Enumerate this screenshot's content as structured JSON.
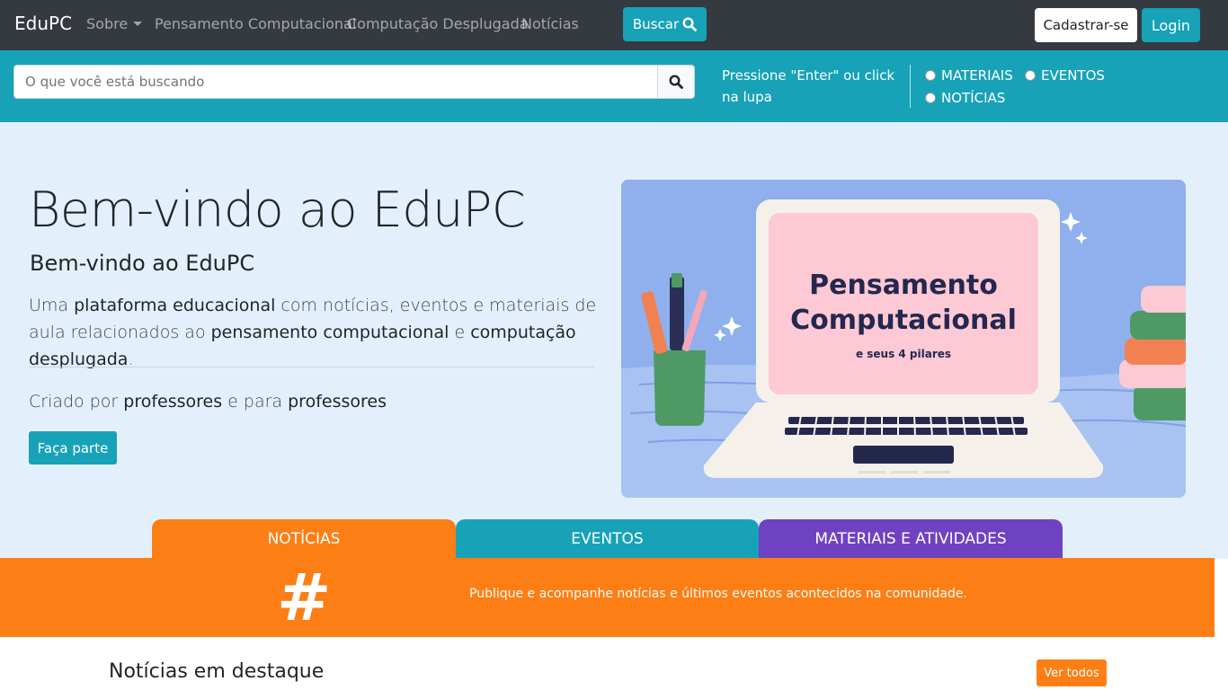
{
  "navbar": {
    "brand": "EduPC",
    "links": [
      "Sobre",
      "Pensamento Computacional",
      "Computação Desplugada",
      "Notícias"
    ],
    "buscar_label": "Buscar",
    "cadastrar_label": "Cadastrar-se",
    "login_label": "Login"
  },
  "search": {
    "placeholder": "O que você está buscando",
    "hint": "Pressione \"Enter\" ou click na lupa",
    "filters": [
      "MATERIAIS",
      "EVENTOS",
      "NOTÍCIAS"
    ]
  },
  "hero": {
    "title": "Bem-vindo ao EduPC",
    "subtitle": "Bem-vindo ao EduPC",
    "lead_parts": [
      "Uma ",
      "plataforma educacional",
      " com notícias, eventos e materiais de aula relacionados ao ",
      "pensamento computacional",
      " e ",
      "computação desplugada",
      "."
    ],
    "made_parts": [
      "Criado por ",
      "professores",
      " e para ",
      "professores"
    ],
    "cta_label": "Faça parte",
    "image_title_1": "Pensamento",
    "image_title_2": "Computacional",
    "image_caption": "e seus 4 pilares"
  },
  "tabs": [
    "NOTÍCIAS",
    "EVENTOS",
    "MATERIAIS E ATIVIDADES"
  ],
  "banner": {
    "symbol": "#",
    "text": "Publique e acompanhe notícias e últimos eventos acontecidos na comunidade."
  },
  "news": {
    "title": "Notícias em destaque",
    "view_all_label": "Ver todos"
  },
  "colors": {
    "navbar": "#343a40",
    "teal": "#17a2b8",
    "orange": "#fd7e14",
    "purple": "#6f42c1",
    "hero_bg": "#e3f0fb"
  }
}
